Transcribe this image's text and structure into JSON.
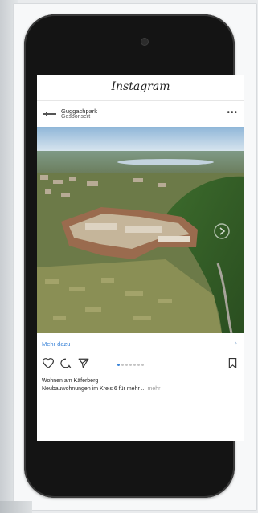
{
  "app": {
    "logo_text": "Instagram"
  },
  "post": {
    "account_name": "Guggachpark",
    "account_subtitle": "Gesponsert",
    "more_icon": "ellipsis-icon",
    "cta_label": "Mehr dazu",
    "carousel": {
      "total": 7,
      "active_index": 0
    },
    "caption_line1": "Wohnen am Käferberg",
    "caption_line2": "Neubauwohnungen im Kreis 6 für mehr ...",
    "caption_more": "mehr"
  },
  "colors": {
    "background": "#e9ebed",
    "phone_frame": "#141414",
    "link_blue": "#3b84d8"
  }
}
